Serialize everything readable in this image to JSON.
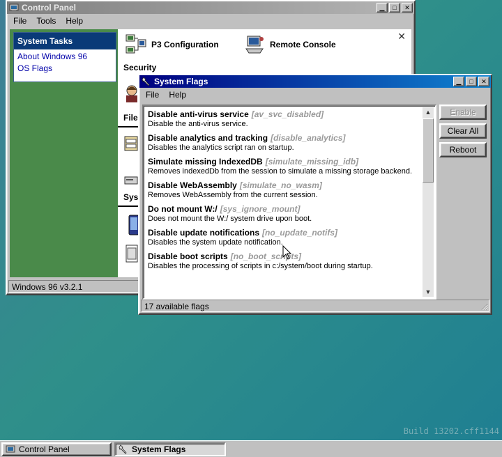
{
  "control_panel": {
    "title": "Control Panel",
    "menu": [
      "File",
      "Tools",
      "Help"
    ],
    "tasks_header": "System Tasks",
    "tasks": [
      "About Windows 96",
      "OS Flags"
    ],
    "items": [
      {
        "label": "P3 Configuration",
        "icon": "network-computers-icon"
      },
      {
        "label": "Remote Console",
        "icon": "remote-computer-icon"
      }
    ],
    "sections": [
      "Security",
      "File",
      "Syst"
    ],
    "status": "Windows 96 v3.2.1"
  },
  "system_flags": {
    "title": "System Flags",
    "menu": [
      "File",
      "Help"
    ],
    "flags": [
      {
        "name": "Disable anti-virus service",
        "key": "[av_svc_disabled]",
        "desc": "Disable the anti-virus service."
      },
      {
        "name": "Disable analytics and tracking",
        "key": "[disable_analytics]",
        "desc": "Disables the analytics script ran on startup."
      },
      {
        "name": "Simulate missing IndexedDB",
        "key": "[simulate_missing_idb]",
        "desc": "Removes indexedDb from the session to simulate a missing storage backend."
      },
      {
        "name": "Disable WebAssembly",
        "key": "[simulate_no_wasm]",
        "desc": "Removes WebAssembly from the current session."
      },
      {
        "name": "Do not mount W:/",
        "key": "[sys_ignore_mount]",
        "desc": "Does not mount the W:/ system drive upon boot."
      },
      {
        "name": "Disable update notifications",
        "key": "[no_update_notifs]",
        "desc": "Disables the system update notification."
      },
      {
        "name": "Disable boot scripts",
        "key": "[no_boot_scripts]",
        "desc": "Disables the processing of scripts in c:/system/boot during startup."
      }
    ],
    "buttons": {
      "enable": "Enable",
      "clear_all": "Clear All",
      "reboot": "Reboot"
    },
    "status": "17 available flags"
  },
  "taskbar": {
    "tasks": [
      "Control Panel",
      "System Flags"
    ]
  },
  "build": "Build 13202.cff1144"
}
